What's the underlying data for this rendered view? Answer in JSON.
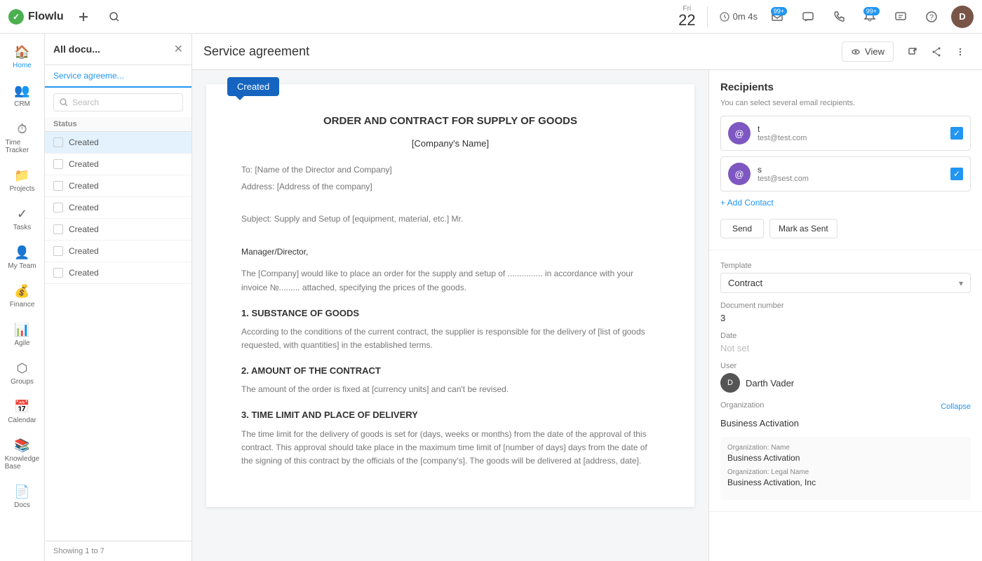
{
  "topbar": {
    "logo_text": "Flowlu",
    "date_day_name": "Fri",
    "date_day": "22",
    "timer_label": "0m 4s",
    "badge_1": "99+",
    "badge_2": "99+"
  },
  "sidebar": {
    "items": [
      {
        "label": "Home",
        "icon": "🏠"
      },
      {
        "label": "CRM",
        "icon": "👥"
      },
      {
        "label": "Time Tracker",
        "icon": "⏱"
      },
      {
        "label": "Projects",
        "icon": "📁"
      },
      {
        "label": "Tasks",
        "icon": "✓"
      },
      {
        "label": "My Team",
        "icon": "👤"
      },
      {
        "label": "Finance",
        "icon": "💰"
      },
      {
        "label": "Agile",
        "icon": "📊"
      },
      {
        "label": "Groups",
        "icon": "⬡"
      },
      {
        "label": "Calendar",
        "icon": "📅"
      },
      {
        "label": "Knowledge Base",
        "icon": "📚"
      },
      {
        "label": "Docs",
        "icon": "📄"
      }
    ]
  },
  "doclist": {
    "title": "All docu...",
    "tab": "Service agreeme...",
    "search_placeholder": "Search",
    "table_header": "Status",
    "items": [
      {
        "status": "Created"
      },
      {
        "status": "Created"
      },
      {
        "status": "Created"
      },
      {
        "status": "Created"
      },
      {
        "status": "Created"
      },
      {
        "status": "Created"
      },
      {
        "status": "Created"
      }
    ],
    "footer": "Showing 1 to 7"
  },
  "document": {
    "header_title": "Service agreement",
    "view_button": "View",
    "tooltip": "Created",
    "title": "ORDER AND CONTRACT FOR SUPPLY OF GOODS",
    "company": "[Company's Name]",
    "address_to": "To: [Name of the Director and Company]",
    "address": "Address: [Address of the company]",
    "subject": "Subject: Supply and Setup of [equipment, material, etc.] Mr.",
    "salutation": "Manager/Director,",
    "intro": "The [Company] would like to place an order for the supply and setup of ............... in accordance with your invoice №......... attached, specifying the prices of the goods.",
    "section1_title": "1. SUBSTANCE OF GOODS",
    "section1_body": "According to the conditions of the current contract, the supplier is responsible for the delivery of [list of goods requested, with quantities] in the established terms.",
    "section2_title": "2. AMOUNT OF THE CONTRACT",
    "section2_body": "The amount of the order is fixed at [currency units] and can't be revised.",
    "section3_title": "3. TIME LIMIT AND PLACE OF DELIVERY",
    "section3_body": "The time limit for the delivery of goods is set for (days, weeks or months) from the date of the approval of this contract. This approval should take place in the maximum time limit of [number of days] days from the date of the signing of this contract by the officials of the [company's]. The goods will be delivered at [address, date]."
  },
  "right_panel": {
    "recipients_title": "Recipients",
    "recipients_subtitle": "You can select several email recipients.",
    "recipient_1_name": "t",
    "recipient_1_email": "test@test.com",
    "recipient_2_name": "s",
    "recipient_2_email": "test@sest.com",
    "add_contact": "+ Add Contact",
    "send_button": "Send",
    "mark_sent_button": "Mark as Sent",
    "template_label": "Template",
    "template_value": "Contract",
    "doc_number_label": "Document number",
    "doc_number_value": "3",
    "date_label": "Date",
    "date_value": "Not set",
    "user_label": "User",
    "user_name": "Darth Vader",
    "org_label": "Organization",
    "collapse_label": "Collapse",
    "org_name_value": "Business Activation",
    "org_field_name_label": "Organization: Name",
    "org_field_name_value": "Business Activation",
    "org_field_legal_label": "Organization: Legal Name",
    "org_field_legal_value": "Business Activation, Inc"
  }
}
